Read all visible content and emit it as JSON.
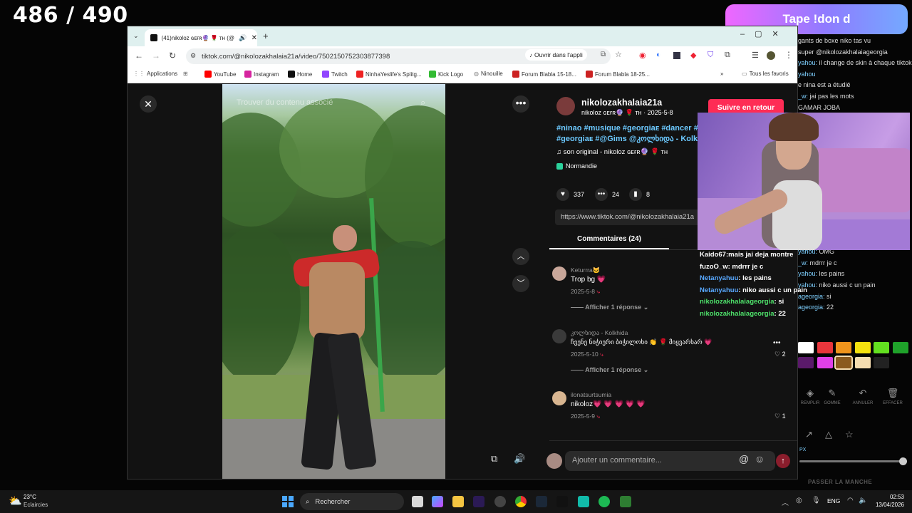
{
  "overlay": {
    "counter": "486 / 490",
    "donate_banner": "Tape !don d",
    "bg_chat": [
      {
        "u": "",
        "t": "gants de boxe niko tas vu"
      },
      {
        "u": "",
        "t": "super @nikolozakhalaiageorgia"
      },
      {
        "u": "yahou:",
        "t": "il change de skin à chaque tiktok"
      },
      {
        "u": "yahou",
        "t": ""
      },
      {
        "u": "",
        "t": "e nina est a étudié"
      },
      {
        "u": "_w:",
        "t": "jai pas les mots"
      },
      {
        "u": "",
        "t": "GAMAR JOBA"
      },
      {
        "u": "",
        "t": ""
      },
      {
        "u": "",
        "t": ""
      },
      {
        "u": "",
        "t": ""
      },
      {
        "u": "",
        "t": ""
      },
      {
        "u": "",
        "t": ""
      },
      {
        "u": "",
        "t": ""
      },
      {
        "u": "",
        "t": ""
      },
      {
        "u": "",
        "t": ""
      },
      {
        "u": "",
        "t": ""
      },
      {
        "u": "",
        "t": ""
      },
      {
        "u": "",
        "t": ""
      },
      {
        "u": "",
        "t": "ontrer ma gl au stream tétais la"
      },
      {
        "u": "yahou:",
        "t": "OMG"
      },
      {
        "u": "_w:",
        "t": "mdrrr je c"
      },
      {
        "u": "yahou:",
        "t": "les pains"
      },
      {
        "u": "yahou:",
        "t": "niko aussi c un pain"
      },
      {
        "u": "ageorgia:",
        "t": "si"
      },
      {
        "u": "ageorgia:",
        "t": "22"
      }
    ],
    "palette_colors": [
      "#ffffff",
      "#e8363c",
      "#f0941c",
      "#f5e10f",
      "#63e020",
      "#1fa22a",
      "#5a1a6a",
      "#e040e8",
      "#8b5a1e",
      "#f5dcb0",
      "#222222"
    ],
    "tools": [
      {
        "icon": "eraser-icon",
        "label": "REMPLIR"
      },
      {
        "icon": "pencil-icon",
        "label": "GOMME"
      },
      {
        "icon": "undo-icon",
        "label": "ANNULER"
      },
      {
        "icon": "trash-icon",
        "label": "EFFACER"
      }
    ],
    "pass_turn": "PASSER LA MANCHE",
    "px_label": "PX"
  },
  "browser": {
    "tab_title": "(41)nikoloz ɢᴇғʀ🔮 🌹 ᴛʜ (@",
    "url": "tiktok.com/@nikolozakhalaia21a/video/7502150752303877398",
    "open_app": "Ouvrir dans l'appli",
    "bookmarks": [
      "Applications",
      "YouTube",
      "Instagram",
      "Home",
      "Twitch",
      "NinhaYeslife's Splitg...",
      "Kick Logo",
      "Ninouille",
      "Forum Blabla 15-18...",
      "Forum Blabla 18-25..."
    ],
    "bookmarks_other": "Tous les favoris"
  },
  "tiktok": {
    "video_overlay": "Trouver du contenu associé",
    "username": "nikolozakhalaia21a",
    "display_name": "nikoloz ɢᴇғʀ🔮 🌹 ᴛʜ",
    "date": "2025-5-8",
    "follow_button": "Suivre en retour",
    "hashtags_line1": "#ninao #musique #georgiaᴇ #dancer #",
    "hashtags_line2": "#georgiaᴇ #@Gims @კოლხიდა - Kolk",
    "sound": "son original - nikoloz ɢᴇғʀ🔮 🌹 ᴛʜ",
    "location": "Normandie",
    "likes": "337",
    "comments_count": "24",
    "saves": "8",
    "link": "https://www.tiktok.com/@nikolozakhalaia21a",
    "comments_tab": "Commentaires (24)",
    "comments": [
      {
        "author": "Keturrra🐱",
        "text": "Trop bg 💗",
        "date": "2025-5-8",
        "replies": "Afficher 1 réponse",
        "likes": ""
      },
      {
        "author": "კოლხიდა - Kolkhida",
        "text": "ჩვენე ნიჭიერი ბიჭილოხი 👏 🌹 მიყვარხარ 💗",
        "date": "2025-5-10",
        "replies": "Afficher 1 réponse",
        "likes": "2"
      },
      {
        "author": "ilonatsurtsumia",
        "text": "nikoloz💗 💗 💗 💗 💗",
        "date": "2025-5-9",
        "replies": "",
        "likes": "1"
      }
    ],
    "comment_placeholder": "Ajouter un commentaire..."
  },
  "cam_chat": [
    {
      "u": "Kaido67:",
      "t": "mais jai deja montre",
      "c": "#ffffff"
    },
    {
      "u": "fuzoO_w",
      "t": ": mdrrr je c",
      "c": "#ffffff"
    },
    {
      "u": "Netanyahuu",
      "t": ": les pains",
      "c": "#58a8ff"
    },
    {
      "u": "Netanyahuu",
      "t": ": niko aussi c un pain",
      "c": "#58a8ff"
    },
    {
      "u": "nikolozakhalaiageorgia",
      "t": ": si",
      "c": "#4ee06a"
    },
    {
      "u": "nikolozakhalaiageorgia",
      "t": ": 22",
      "c": "#4ee06a"
    }
  ],
  "taskbar": {
    "temp": "23°C",
    "weather": "Eclaircies",
    "search": "Rechercher",
    "lang": "ENG",
    "time": "02:53",
    "date": "13/04/2026"
  }
}
